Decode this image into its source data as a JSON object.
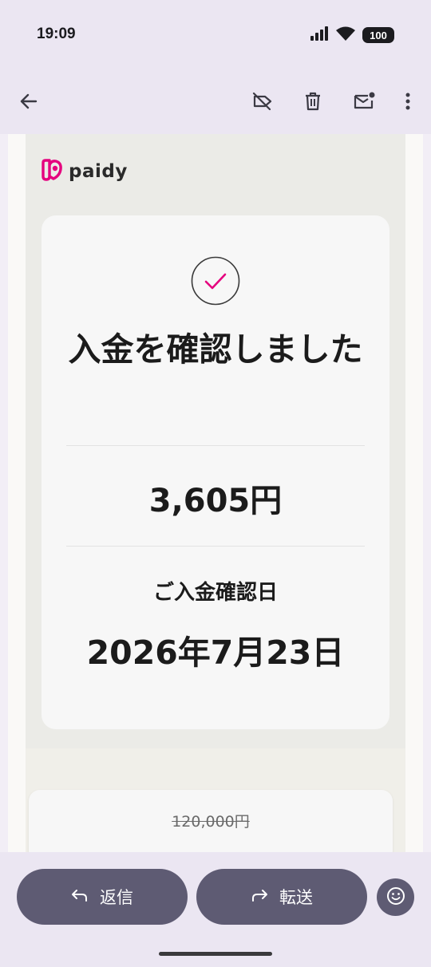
{
  "status_bar": {
    "time": "19:09",
    "battery": "100",
    "icons": [
      "signal-icon",
      "wifi-icon",
      "battery-icon"
    ]
  },
  "app_bar": {
    "icons": [
      "back-arrow-icon",
      "label-off-icon",
      "trash-icon",
      "mark-unread-icon",
      "more-vert-icon"
    ]
  },
  "email": {
    "brand": "paidy",
    "brand_color": "#e5007e",
    "title": "入金を確認しました",
    "amount": "3,605円",
    "date_label": "ご入金確認日",
    "date_value": "2026年7月23日",
    "next_card_old_price": "120,000円"
  },
  "actions": {
    "reply_label": "返信",
    "forward_label": "転送"
  },
  "colors": {
    "accent": "#e5007e",
    "button_bg": "#5e5b73",
    "chrome_bg": "#ebe6f2"
  }
}
